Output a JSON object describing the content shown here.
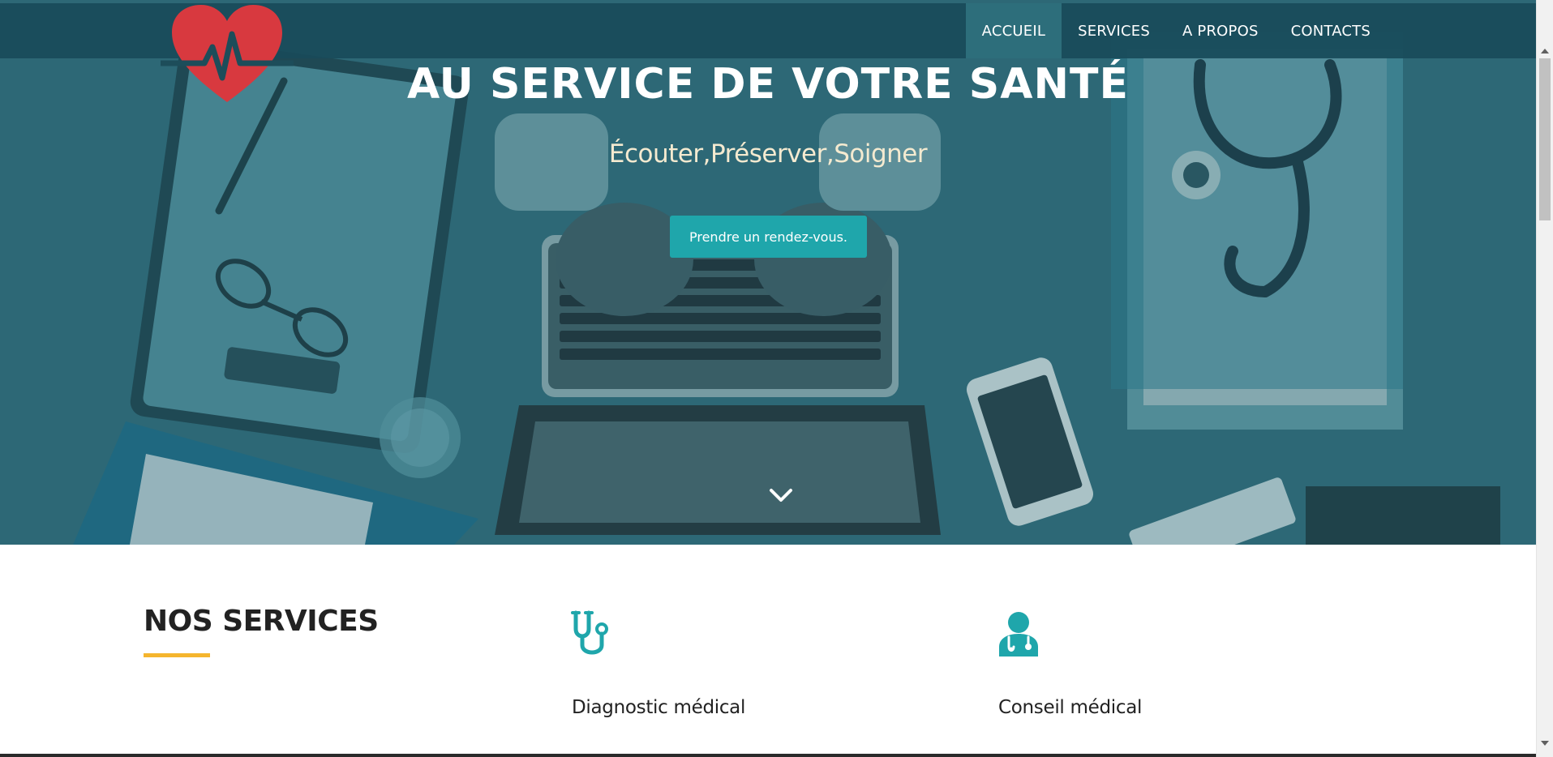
{
  "nav": {
    "items": [
      {
        "label": "ACCUEIL",
        "active": true
      },
      {
        "label": "SERVICES",
        "active": false
      },
      {
        "label": "A PROPOS",
        "active": false
      },
      {
        "label": "CONTACTS",
        "active": false
      }
    ]
  },
  "hero": {
    "title": "AU SERVICE DE VOTRE SANTÉ",
    "subtitle": "Écouter,Préserver,Soigner",
    "cta_label": "Prendre un rendez-vous."
  },
  "services": {
    "heading": "NOS SERVICES",
    "items": [
      {
        "title": "Diagnostic médical",
        "icon": "stethoscope-icon"
      },
      {
        "title": "Conseil médical",
        "icon": "doctor-icon"
      }
    ]
  },
  "colors": {
    "nav_bg": "#194b5a",
    "hero_tint": "#2d6674",
    "accent_teal": "#1fa6ab",
    "logo_red": "#d8393f",
    "underline_yellow": "#f5b52e"
  }
}
